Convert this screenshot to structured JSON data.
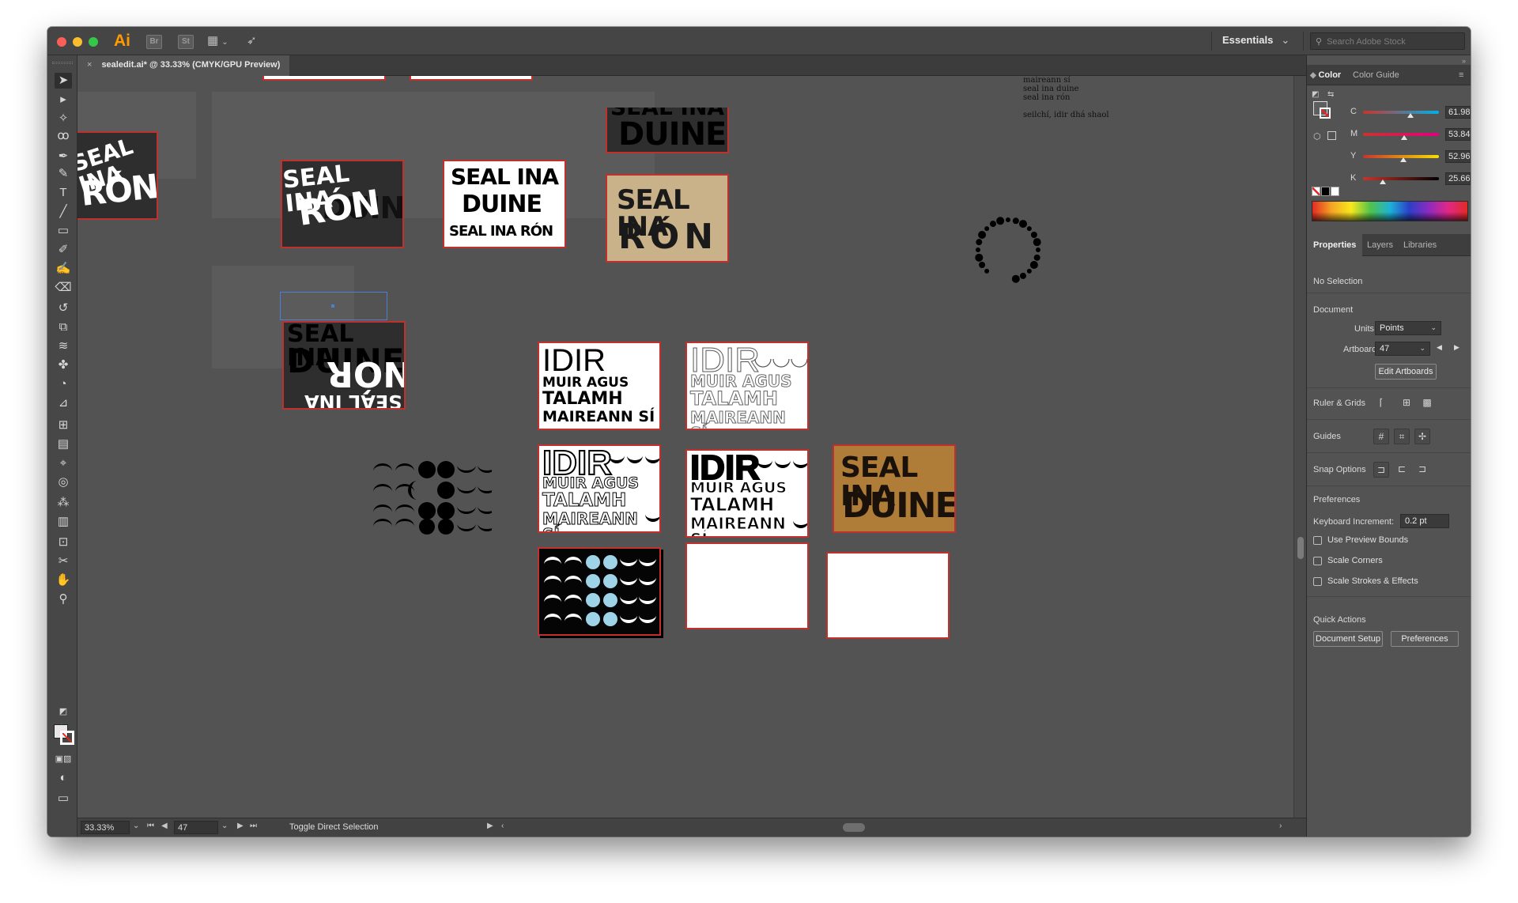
{
  "titlebar": {
    "app_logo": "Ai",
    "bridge": "Br",
    "stock": "St",
    "workspace": "Essentials",
    "search_placeholder": "Search Adobe Stock"
  },
  "document": {
    "tab_title": "sealedit.ai* @ 33.33% (CMYK/GPU Preview)",
    "close": "×"
  },
  "canvas": {
    "artboards": [
      {
        "lines": [
          "SEAL INA",
          "RÓN"
        ]
      },
      {
        "lines": [
          "SEAL INA",
          "RÓN",
          "DUINE"
        ]
      },
      {
        "lines": [
          "SEAL INA",
          "DUINE",
          "SEAL INA RÓN"
        ]
      },
      {
        "lines": [
          "SEAL INA",
          "DUINE"
        ]
      },
      {
        "lines": [
          "SEAL INA",
          "RÓN"
        ]
      },
      {
        "lines": [
          "SEAL INA",
          "DUINE",
          "NÓR",
          "SEAL INA"
        ]
      },
      {
        "lines": [
          "IDIR",
          "MUIR AGUS",
          "TALAMH",
          "MAIREANN SÍ"
        ]
      },
      {
        "lines": [
          "IDIR",
          "MUIR AGUS",
          "TALAMH",
          "MAIREANN SÍ"
        ]
      },
      {
        "lines": [
          "IDIR",
          "MUIR AGUS",
          "TALAMH",
          "MAIREANN SÍ"
        ]
      },
      {
        "lines": [
          "IDIR",
          "MUIR AGUS",
          "TALAMH",
          "MAIREANN SÍ"
        ]
      },
      {
        "lines": [
          "SEAL INA",
          "DUINE"
        ]
      }
    ],
    "poem": [
      "maireann sí",
      "seal ina duine",
      "seal ina rón",
      "",
      "seilchí, idir dhá shaol"
    ]
  },
  "statusbar": {
    "zoom": "33.33%",
    "artboard": "47",
    "tool_status": "Toggle Direct Selection"
  },
  "color_panel": {
    "tabs": [
      "Color",
      "Color Guide"
    ],
    "cmyk": [
      {
        "label": "C",
        "value": "61.98",
        "unit": "%",
        "level": 0.62,
        "color": "#00b0e8"
      },
      {
        "label": "M",
        "value": "53.84",
        "unit": "%",
        "level": 0.54,
        "color": "#e4007c"
      },
      {
        "label": "Y",
        "value": "52.96",
        "unit": "%",
        "level": 0.53,
        "color": "#f5e100"
      },
      {
        "label": "K",
        "value": "25.66",
        "unit": "%",
        "level": 0.26,
        "color": "#000000"
      }
    ]
  },
  "properties_panel": {
    "tabs": [
      "Properties",
      "Layers",
      "Libraries"
    ],
    "selection": "No Selection",
    "document_header": "Document",
    "units_label": "Units:",
    "units_value": "Points",
    "artboard_label": "Artboard:",
    "artboard_value": "47",
    "edit_artboards": "Edit Artboards",
    "ruler_grids": "Ruler & Grids",
    "guides": "Guides",
    "snap_options": "Snap Options",
    "preferences_header": "Preferences",
    "keyboard_increment_label": "Keyboard Increment:",
    "keyboard_increment_value": "0.2 pt",
    "checkboxes": [
      "Use Preview Bounds",
      "Scale Corners",
      "Scale Strokes & Effects"
    ],
    "quick_actions": "Quick Actions",
    "document_setup": "Document Setup",
    "preferences_button": "Preferences"
  }
}
